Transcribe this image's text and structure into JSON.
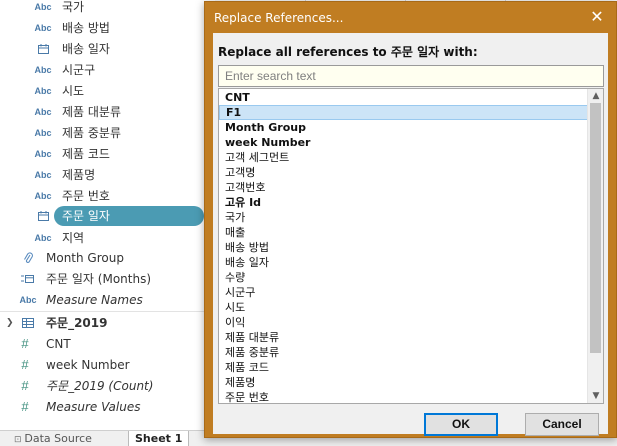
{
  "data_pane": {
    "fields": [
      {
        "icon": "Abc",
        "icon_name": "string-type-icon",
        "label": "국가"
      },
      {
        "icon": "Abc",
        "icon_name": "string-type-icon",
        "label": "배송 방법"
      },
      {
        "icon": "",
        "icon_name": "date-type-icon",
        "label": "배송 일자"
      },
      {
        "icon": "Abc",
        "icon_name": "string-type-icon",
        "label": "시군구"
      },
      {
        "icon": "Abc",
        "icon_name": "string-type-icon",
        "label": "시도"
      },
      {
        "icon": "Abc",
        "icon_name": "string-type-icon",
        "label": "제품 대분류"
      },
      {
        "icon": "Abc",
        "icon_name": "string-type-icon",
        "label": "제품 중분류"
      },
      {
        "icon": "Abc",
        "icon_name": "string-type-icon",
        "label": "제품 코드"
      },
      {
        "icon": "Abc",
        "icon_name": "string-type-icon",
        "label": "제품명"
      },
      {
        "icon": "Abc",
        "icon_name": "string-type-icon",
        "label": "주문 번호"
      },
      {
        "icon": "",
        "icon_name": "date-type-icon",
        "label": "주문 일자",
        "selected": true
      },
      {
        "icon": "Abc",
        "icon_name": "string-type-icon",
        "label": "지역"
      }
    ],
    "group_fields": [
      {
        "icon_name": "paperclip-icon",
        "label": "Month Group"
      },
      {
        "icon_name": "date-group-icon",
        "label": "주문 일자 (Months)"
      },
      {
        "icon": "Abc",
        "icon_name": "string-type-icon",
        "label": "Measure Names"
      }
    ],
    "table": {
      "label": "주문_2019",
      "icon_name": "table-icon"
    },
    "measures": [
      {
        "icon": "#",
        "icon_name": "number-calc-icon",
        "label": "CNT"
      },
      {
        "icon": "#",
        "icon_name": "number-calc-icon",
        "label": "week Number"
      },
      {
        "icon": "#",
        "icon_name": "number-type-icon",
        "label": "주문_2019 (Count)"
      },
      {
        "icon": "#",
        "icon_name": "number-type-icon",
        "label": "Measure Values"
      }
    ]
  },
  "tabs": {
    "data_source": "Data Source",
    "sheet1": "Sheet 1"
  },
  "dialog": {
    "title": "Replace References...",
    "close_glyph": "✕",
    "prompt": "Replace all references to 주문 일자 with:",
    "search_placeholder": "Enter search text",
    "options": [
      {
        "label": "CNT",
        "bold": true
      },
      {
        "label": "F1",
        "bold": true,
        "highlighted": true
      },
      {
        "label": "Month Group",
        "bold": true
      },
      {
        "label": "week Number",
        "bold": true
      },
      {
        "label": "고객 세그먼트"
      },
      {
        "label": "고객명"
      },
      {
        "label": "고객번호"
      },
      {
        "label": "고유 Id",
        "bold": true
      },
      {
        "label": "국가"
      },
      {
        "label": "매출"
      },
      {
        "label": "배송 방법"
      },
      {
        "label": "배송 일자"
      },
      {
        "label": "수량"
      },
      {
        "label": "시군구"
      },
      {
        "label": "시도"
      },
      {
        "label": "이익"
      },
      {
        "label": "제품 대분류"
      },
      {
        "label": "제품 중분류"
      },
      {
        "label": "제품 코드"
      },
      {
        "label": "제품명"
      },
      {
        "label": "주문 번호"
      }
    ],
    "ok_label": "OK",
    "cancel_label": "Cancel"
  },
  "colors": {
    "dialog_frame": "#c07d22",
    "selected_pill": "#4b9bb3",
    "list_highlight": "#cce4f7"
  }
}
